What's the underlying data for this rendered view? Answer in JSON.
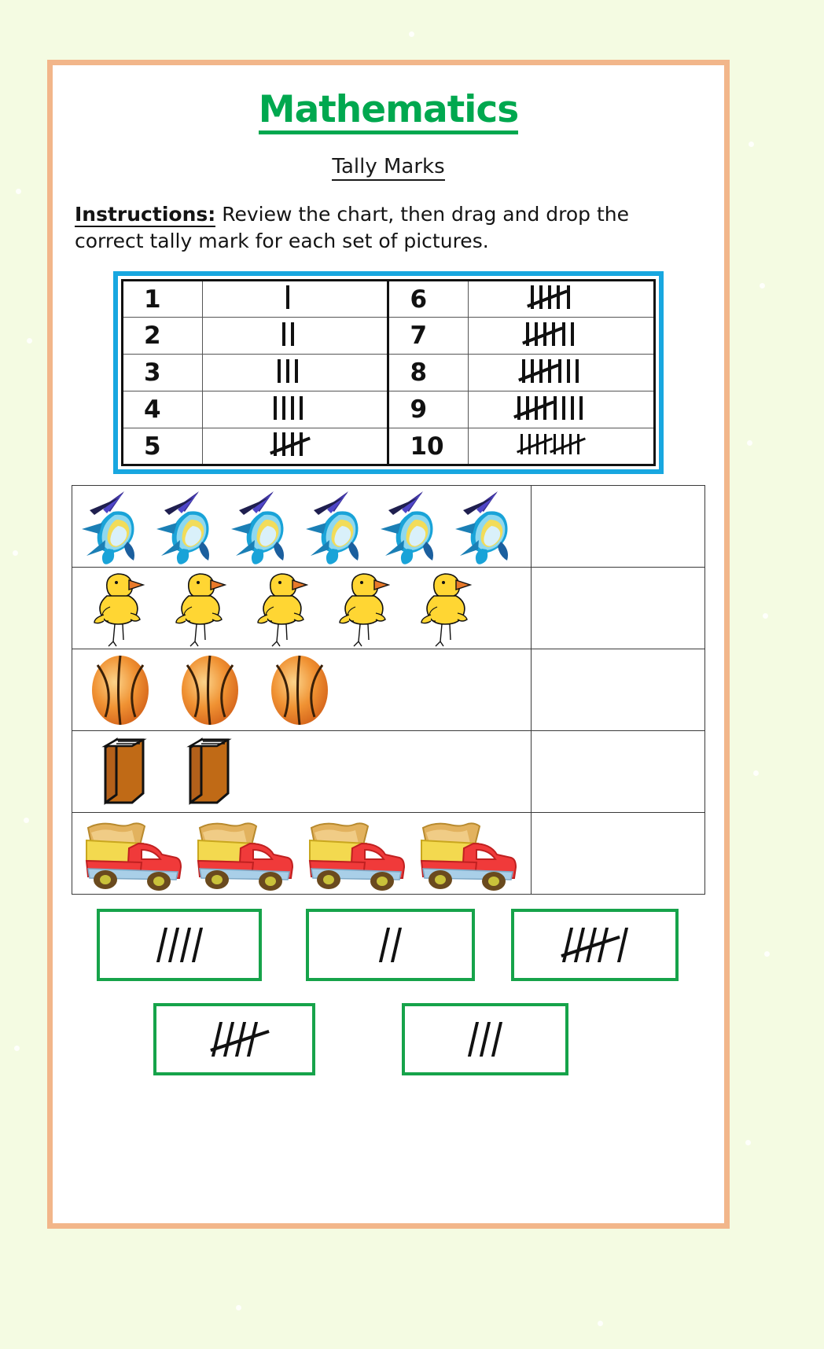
{
  "page": {
    "background_color": "#f4fbe2",
    "sheet_border_color": "#f2b68a",
    "title": "Mathematics",
    "title_color": "#00a84f",
    "subtitle": "Tally Marks",
    "instructions_lead": "Instructions:",
    "instructions_text": " Review the chart, then drag and drop the correct tally mark for each set of pictures."
  },
  "reference_chart": {
    "border_color": "#18a7e0",
    "rows": [
      {
        "left_number": "1",
        "left_tally": "I",
        "left_count": 1,
        "right_number": "6",
        "right_tally": "IIII I",
        "right_count": 6
      },
      {
        "left_number": "2",
        "left_tally": "II",
        "left_count": 2,
        "right_number": "7",
        "right_tally": "IIII II",
        "right_count": 7
      },
      {
        "left_number": "3",
        "left_tally": "III",
        "left_count": 3,
        "right_number": "8",
        "right_tally": "IIII III",
        "right_count": 8
      },
      {
        "left_number": "4",
        "left_tally": "IIII",
        "left_count": 4,
        "right_number": "9",
        "right_tally": "IIII IIII",
        "right_count": 9
      },
      {
        "left_number": "5",
        "left_tally": "IIII-cross",
        "left_count": 5,
        "right_number": "10",
        "right_tally": "IIII IIII x2",
        "right_count": 10
      }
    ]
  },
  "picture_rows": [
    {
      "item": "marlin-fish",
      "count": 6,
      "answer": ""
    },
    {
      "item": "chick",
      "count": 5,
      "answer": ""
    },
    {
      "item": "basketball",
      "count": 3,
      "answer": ""
    },
    {
      "item": "book",
      "count": 2,
      "answer": ""
    },
    {
      "item": "dump-truck",
      "count": 4,
      "answer": ""
    }
  ],
  "answer_tiles": {
    "border_color": "#16a34a",
    "row1": [
      {
        "label": "////",
        "count": 4,
        "has_cross": false
      },
      {
        "label": "//",
        "count": 2,
        "has_cross": false
      },
      {
        "label": "#### /",
        "count": 6,
        "has_cross": true
      }
    ],
    "row2": [
      {
        "label": "####",
        "count": 5,
        "has_cross": true
      },
      {
        "label": "///",
        "count": 3,
        "has_cross": false
      }
    ]
  }
}
